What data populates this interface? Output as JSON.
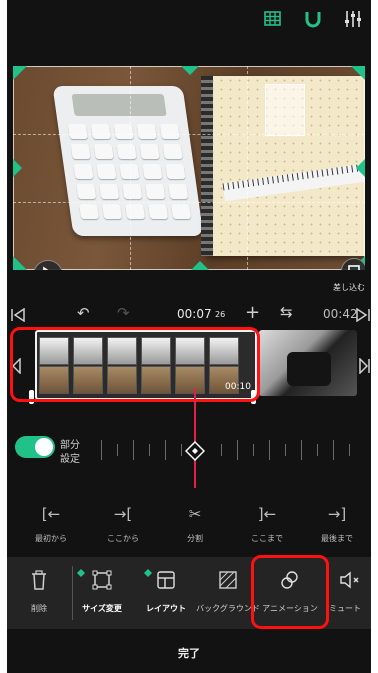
{
  "top_toolbar": {
    "icons": [
      "grid-icon",
      "magnet-icon",
      "sliders-icon"
    ],
    "accent_color": "#21c28a"
  },
  "preview": {
    "replace_label": "差し込む"
  },
  "timeline_controls": {
    "current_time": "00:07",
    "current_frame": "26",
    "total_time": "00:42"
  },
  "clip": {
    "duration": "00:10"
  },
  "partial_toggle": {
    "label_line1": "部分",
    "label_line2": "設定",
    "on": true
  },
  "edit_tools": [
    {
      "icon": "trim-start-icon",
      "label": "最初から"
    },
    {
      "icon": "trim-from-here-icon",
      "label": "ここから"
    },
    {
      "icon": "split-icon",
      "label": "分割"
    },
    {
      "icon": "trim-to-here-icon",
      "label": "ここまで"
    },
    {
      "icon": "trim-end-icon",
      "label": "最後まで"
    }
  ],
  "bottom_toolbar": [
    {
      "icon": "trash-icon",
      "label": "削除"
    },
    {
      "icon": "resize-icon",
      "label": "サイズ変更"
    },
    {
      "icon": "layout-icon",
      "label": "レイアウト"
    },
    {
      "icon": "background-icon",
      "label": "バックグラウンド"
    },
    {
      "icon": "animation-icon",
      "label": "アニメーション"
    },
    {
      "icon": "mute-icon",
      "label": "ミュート"
    }
  ],
  "done_label": "完了"
}
